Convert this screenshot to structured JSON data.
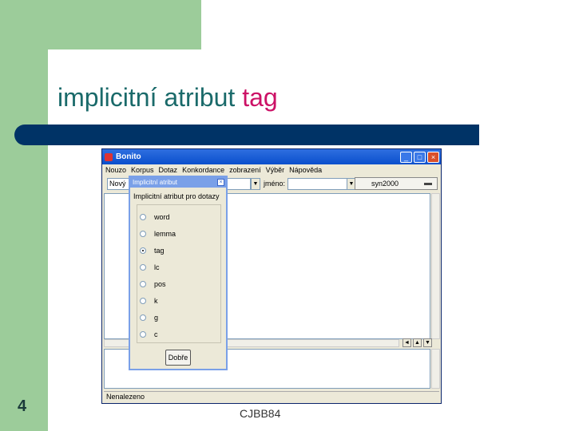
{
  "slide": {
    "title_main": "implicitní atribut ",
    "title_accent": "tag",
    "page_number": "4",
    "footer": "CJBB84"
  },
  "app": {
    "title": "Bonito",
    "menu": [
      "Nouzo",
      "Korpus",
      "Dotaz",
      "Konkordance",
      "zobrazení",
      "Výběr",
      "Nápověda"
    ],
    "toolbar": {
      "query_label": "Nový",
      "name_label": "jméno:",
      "button_label": "syn2000"
    },
    "status": "Nenalezeno"
  },
  "dialog": {
    "title": "Implicitní atribut",
    "group_label": "Implicitní atribut pro dotazy",
    "options": [
      "word",
      "lemma",
      "tag",
      "lc",
      "pos",
      "k",
      "g",
      "c"
    ],
    "selected": "tag",
    "ok_label": "Dobře"
  }
}
